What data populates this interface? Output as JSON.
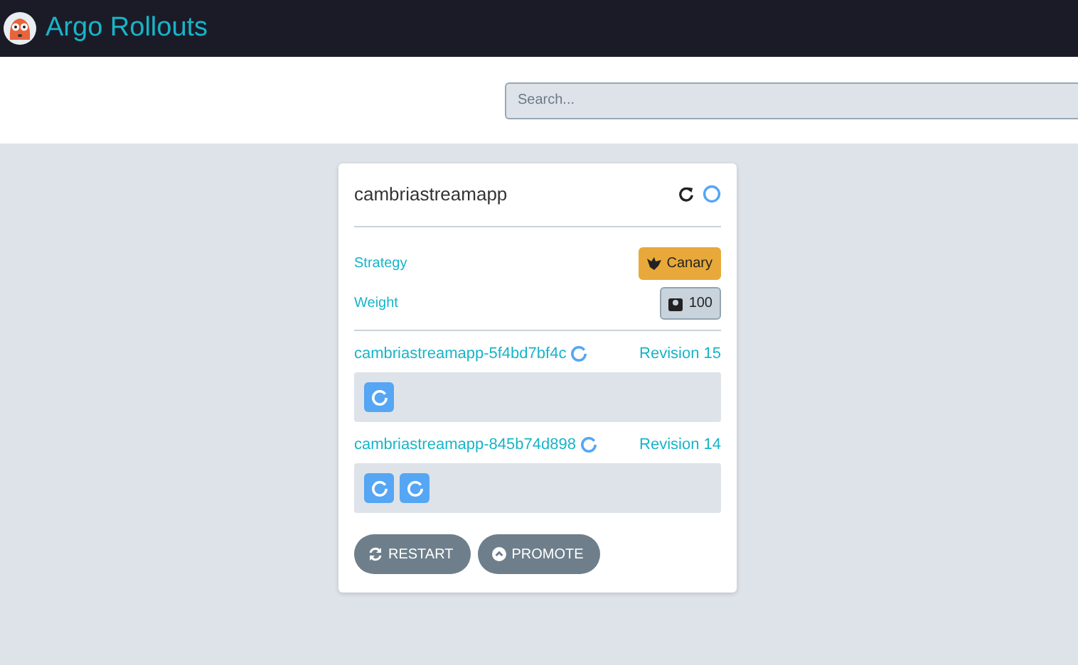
{
  "header": {
    "title": "Argo Rollouts"
  },
  "search": {
    "placeholder": "Search..."
  },
  "rollout": {
    "name": "cambriastreamapp",
    "kind": "progressing",
    "details": [
      {
        "kind": "strategy",
        "label": "Strategy",
        "value": "Canary"
      },
      {
        "kind": "weight",
        "label": "Weight",
        "value": "100"
      }
    ],
    "replica_sets": [
      {
        "name": "cambriastreamapp-5f4bd7bf4c",
        "kind": "progressing",
        "revision": "Revision 15",
        "pods": [
          {
            "kind": "progressing"
          }
        ]
      },
      {
        "name": "cambriastreamapp-845b74d898",
        "kind": "progressing",
        "revision": "Revision 14",
        "pods": [
          {
            "kind": "progressing"
          },
          {
            "kind": "progressing"
          }
        ]
      }
    ],
    "actions": [
      {
        "kind": "restart",
        "label": "RESTART"
      },
      {
        "kind": "promote",
        "label": "PROMOTE"
      }
    ]
  }
}
